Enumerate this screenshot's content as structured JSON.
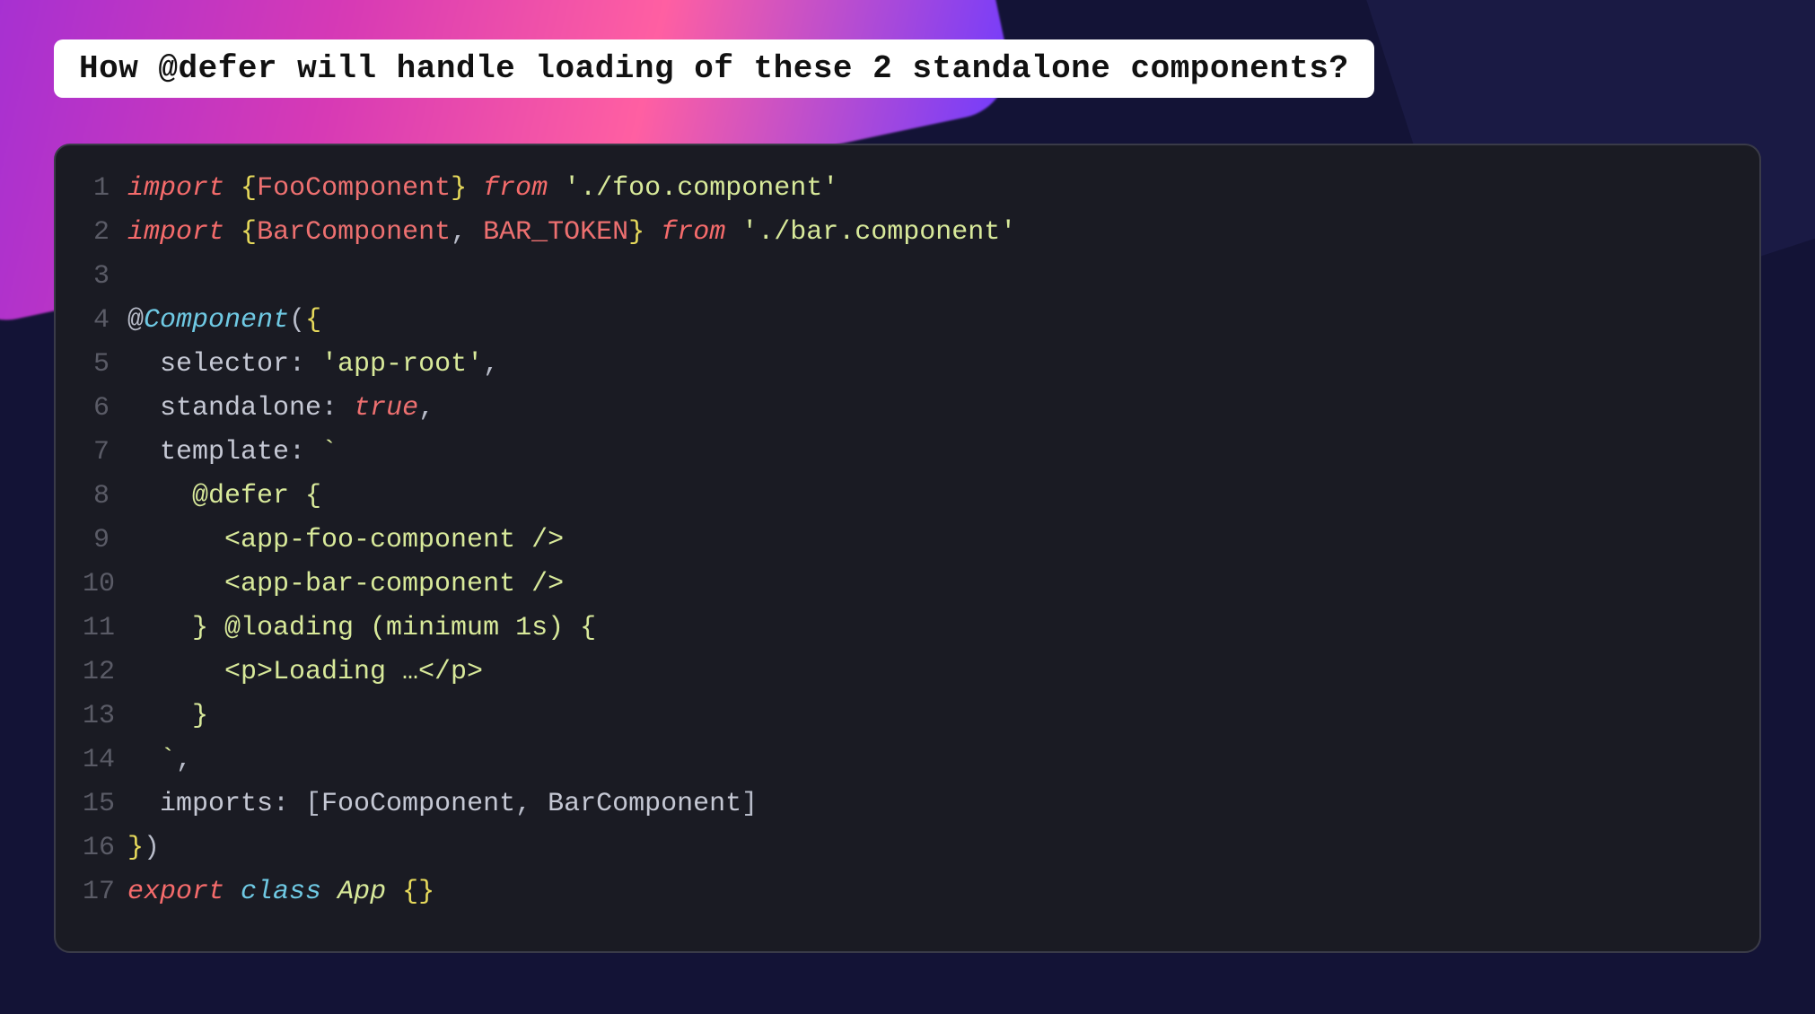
{
  "title": "How @defer will handle loading of these 2 standalone components?",
  "code": {
    "lines": [
      {
        "n": "1",
        "tokens": [
          [
            "kw",
            "import"
          ],
          [
            "",
            ""
          ],
          [
            "ident",
            " "
          ],
          [
            "brace",
            "{"
          ],
          [
            "type",
            "FooComponent"
          ],
          [
            "brace",
            "}"
          ],
          [
            "ident",
            " "
          ],
          [
            "kw",
            "from"
          ],
          [
            "ident",
            " "
          ],
          [
            "str",
            "'./foo.component'"
          ]
        ]
      },
      {
        "n": "2",
        "tokens": [
          [
            "kw",
            "import"
          ],
          [
            "ident",
            " "
          ],
          [
            "brace",
            "{"
          ],
          [
            "type",
            "BarComponent"
          ],
          [
            "punc",
            ", "
          ],
          [
            "type",
            "BAR_TOKEN"
          ],
          [
            "brace",
            "}"
          ],
          [
            "ident",
            " "
          ],
          [
            "kw",
            "from"
          ],
          [
            "ident",
            " "
          ],
          [
            "str",
            "'./bar.component'"
          ]
        ]
      },
      {
        "n": "3",
        "tokens": [
          [
            "ident",
            ""
          ]
        ]
      },
      {
        "n": "4",
        "tokens": [
          [
            "at",
            "@"
          ],
          [
            "fn",
            "Component"
          ],
          [
            "punc",
            "("
          ],
          [
            "brace",
            "{"
          ]
        ]
      },
      {
        "n": "5",
        "tokens": [
          [
            "ident",
            "  selector"
          ],
          [
            "punc",
            ": "
          ],
          [
            "str",
            "'app-root'"
          ],
          [
            "punc",
            ","
          ]
        ]
      },
      {
        "n": "6",
        "tokens": [
          [
            "ident",
            "  standalone"
          ],
          [
            "punc",
            ": "
          ],
          [
            "bool",
            "true"
          ],
          [
            "punc",
            ","
          ]
        ]
      },
      {
        "n": "7",
        "tokens": [
          [
            "ident",
            "  template"
          ],
          [
            "punc",
            ": "
          ],
          [
            "str",
            "`"
          ]
        ]
      },
      {
        "n": "8",
        "tokens": [
          [
            "str",
            "    @defer {"
          ]
        ]
      },
      {
        "n": "9",
        "tokens": [
          [
            "str",
            "      <app-foo-component />"
          ]
        ]
      },
      {
        "n": "10",
        "tokens": [
          [
            "str",
            "      <app-bar-component />"
          ]
        ]
      },
      {
        "n": "11",
        "tokens": [
          [
            "str",
            "    } @loading (minimum 1s) {"
          ]
        ]
      },
      {
        "n": "12",
        "tokens": [
          [
            "str",
            "      <p>Loading …</p>"
          ]
        ]
      },
      {
        "n": "13",
        "tokens": [
          [
            "str",
            "    }"
          ]
        ]
      },
      {
        "n": "14",
        "tokens": [
          [
            "str",
            "  `"
          ],
          [
            "punc",
            ","
          ]
        ]
      },
      {
        "n": "15",
        "tokens": [
          [
            "ident",
            "  imports"
          ],
          [
            "punc",
            ": ["
          ],
          [
            "ident",
            "FooComponent"
          ],
          [
            "punc",
            ", "
          ],
          [
            "ident",
            "BarComponent"
          ],
          [
            "punc",
            "]"
          ]
        ]
      },
      {
        "n": "16",
        "tokens": [
          [
            "brace",
            "}"
          ],
          [
            "punc",
            ")"
          ]
        ]
      },
      {
        "n": "17",
        "tokens": [
          [
            "kw",
            "export"
          ],
          [
            "ident",
            " "
          ],
          [
            "storage",
            "class"
          ],
          [
            "ident",
            " "
          ],
          [
            "class",
            "App"
          ],
          [
            "ident",
            " "
          ],
          [
            "brace",
            "{}"
          ]
        ]
      }
    ]
  }
}
